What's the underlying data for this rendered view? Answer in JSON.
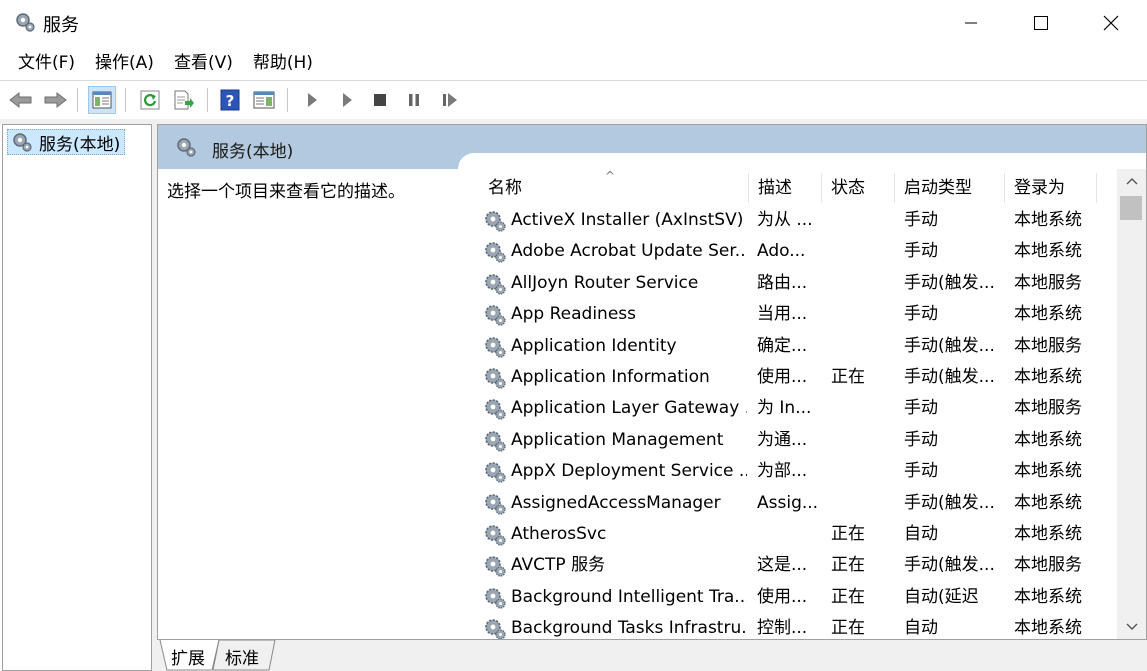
{
  "window": {
    "title": "服务"
  },
  "menu": [
    "文件(F)",
    "操作(A)",
    "查看(V)",
    "帮助(H)"
  ],
  "toolbar": [
    "back-icon",
    "forward-icon",
    "show-hide-console-tree-icon",
    "refresh-icon",
    "export-list-icon",
    "help-icon",
    "properties-pane-icon",
    "start-service-icon",
    "start-service-alt-icon",
    "stop-service-icon",
    "pause-service-icon",
    "resume-service-icon"
  ],
  "tree": {
    "root_label": "服务(本地)"
  },
  "pane": {
    "header": "服务(本地)",
    "description_prompt": "选择一个项目来查看它的描述。"
  },
  "columns": {
    "name": "名称",
    "description": "描述",
    "status": "状态",
    "startup": "启动类型",
    "logon": "登录为"
  },
  "services": [
    {
      "name": "ActiveX Installer (AxInstSV)",
      "desc": "为从 ...",
      "state": "",
      "start": "手动",
      "logon": "本地系统"
    },
    {
      "name": "Adobe Acrobat Update Ser...",
      "desc": "Ado...",
      "state": "",
      "start": "手动",
      "logon": "本地系统"
    },
    {
      "name": "AllJoyn Router Service",
      "desc": "路由...",
      "state": "",
      "start": "手动(触发...",
      "logon": "本地服务"
    },
    {
      "name": "App Readiness",
      "desc": "当用...",
      "state": "",
      "start": "手动",
      "logon": "本地系统"
    },
    {
      "name": "Application Identity",
      "desc": "确定...",
      "state": "",
      "start": "手动(触发...",
      "logon": "本地服务"
    },
    {
      "name": "Application Information",
      "desc": "使用...",
      "state": "正在",
      "start": "手动(触发...",
      "logon": "本地系统"
    },
    {
      "name": "Application Layer Gateway ...",
      "desc": "为 In...",
      "state": "",
      "start": "手动",
      "logon": "本地服务"
    },
    {
      "name": "Application Management",
      "desc": "为通...",
      "state": "",
      "start": "手动",
      "logon": "本地系统"
    },
    {
      "name": "AppX Deployment Service ...",
      "desc": "为部...",
      "state": "",
      "start": "手动",
      "logon": "本地系统"
    },
    {
      "name": "AssignedAccessManager",
      "desc": "Assig...",
      "state": "",
      "start": "手动(触发...",
      "logon": "本地系统"
    },
    {
      "name": "AtherosSvc",
      "desc": "",
      "state": "正在",
      "start": "自动",
      "logon": "本地系统"
    },
    {
      "name": "AVCTP 服务",
      "desc": "这是...",
      "state": "正在",
      "start": "手动(触发...",
      "logon": "本地服务"
    },
    {
      "name": "Background Intelligent Tra...",
      "desc": "使用...",
      "state": "正在",
      "start": "自动(延迟",
      "logon": "本地系统"
    },
    {
      "name": "Background Tasks Infrastru...",
      "desc": "控制...",
      "state": "正在",
      "start": "自动",
      "logon": "本地系统"
    }
  ],
  "tabs": [
    "扩展",
    "标准"
  ]
}
